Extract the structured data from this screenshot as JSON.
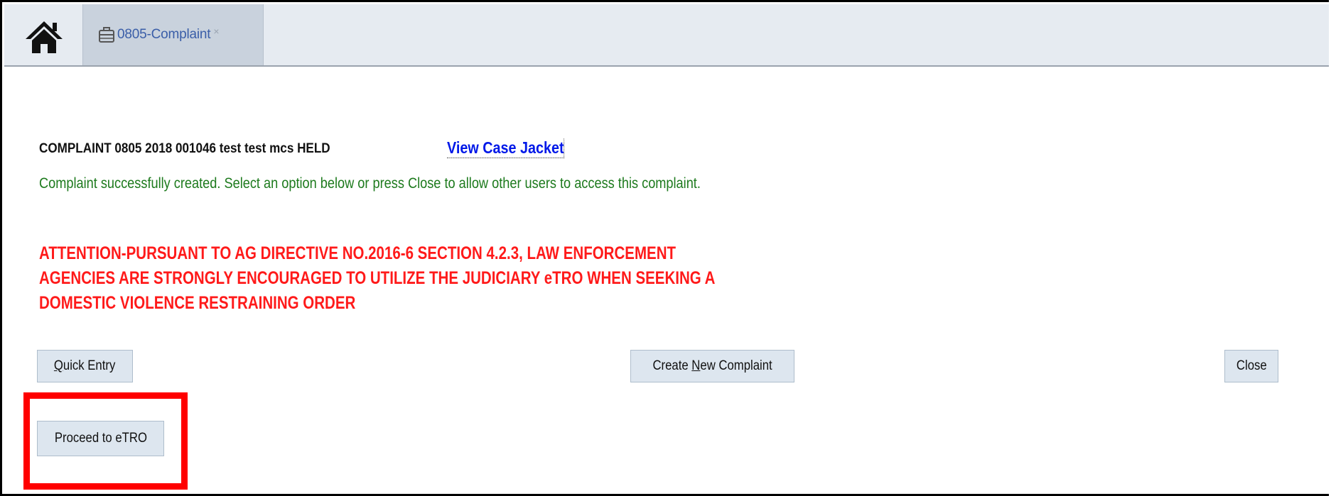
{
  "tabbar": {
    "home_icon": "home-icon",
    "tab": {
      "icon": "briefcase-icon",
      "label": "0805-Complaint",
      "close": "×"
    }
  },
  "content": {
    "complaint_line": "COMPLAINT 0805 2018 001046 test test mcs HELD",
    "view_case_jacket": "View Case Jacket",
    "success_message": "Complaint successfully created. Select an option below or press Close to allow other users to access this complaint.",
    "attention_lines": [
      "ATTENTION-PURSUANT TO AG DIRECTIVE NO.2016-6 SECTION 4.2.3, LAW ENFORCEMENT",
      "AGENCIES ARE STRONGLY ENCOURAGED TO UTILIZE THE JUDICIARY eTRO WHEN SEEKING A",
      "DOMESTIC VIOLENCE RESTRAINING ORDER"
    ]
  },
  "buttons": {
    "quick_entry": {
      "first": "Q",
      "rest": "uick Entry"
    },
    "create_new": {
      "before": "Create ",
      "underlined": "N",
      "after": "ew Complaint"
    },
    "close": "Close",
    "proceed_etro": "Proceed to eTRO"
  },
  "colors": {
    "tabbar_bg": "#e6ebf1",
    "tab_active_bg": "#c9d2dd",
    "tab_label": "#3a5ea8",
    "link": "#0018e8",
    "success": "#1d7a1d",
    "attention": "#ff1a1a",
    "button_bg": "#dde6ef",
    "highlight_box": "#ff0000"
  }
}
